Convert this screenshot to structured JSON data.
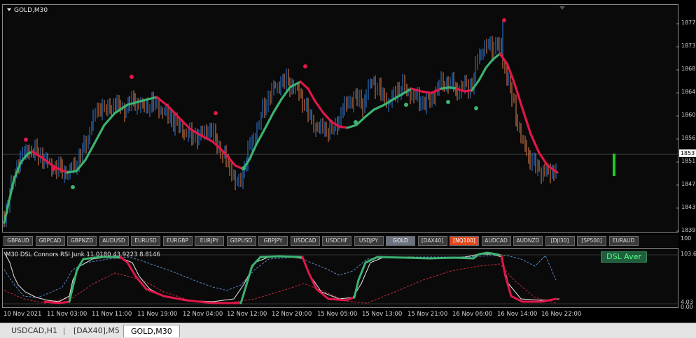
{
  "colors": {
    "background": "#000000",
    "bull_candle": "#2f7fe0",
    "bear_candle": "#e8834a",
    "dsl_up": "#3cb371",
    "dsl_down": "#e0174a",
    "rsi_line": "#e8e8e8",
    "level_blue": "#5a8ac8",
    "level_red": "#c8283c",
    "signal_bar": "#22cc22",
    "alert_button": "#e2451a"
  },
  "chart": {
    "symbol_title": "GOLD,M30",
    "current_price": "1853",
    "price_ticks": [
      "1877",
      "1873",
      "1868",
      "1864",
      "1860",
      "1856",
      "1851",
      "1847",
      "1843",
      "1839"
    ],
    "price_range": [
      1839,
      1879
    ],
    "current_price_value": 1853
  },
  "symbols": [
    {
      "label": "GBPAUD",
      "state": "normal"
    },
    {
      "label": "GBPCAD",
      "state": "normal"
    },
    {
      "label": "GBPNZD",
      "state": "normal"
    },
    {
      "label": "AUDUSD",
      "state": "normal"
    },
    {
      "label": "EURUSD",
      "state": "normal"
    },
    {
      "label": "EURGBP",
      "state": "normal"
    },
    {
      "label": "EURJPY",
      "state": "normal"
    },
    {
      "label": "GBPUSD",
      "state": "normal"
    },
    {
      "label": "GBPJPY",
      "state": "normal"
    },
    {
      "label": "USDCAD",
      "state": "normal"
    },
    {
      "label": "USDCHF",
      "state": "normal"
    },
    {
      "label": "USDJPY",
      "state": "normal"
    },
    {
      "label": "GOLD",
      "state": "active"
    },
    {
      "label": "[DAX40]",
      "state": "normal"
    },
    {
      "label": "[NQ100]",
      "state": "alert"
    },
    {
      "label": "AUDCAD",
      "state": "normal"
    },
    {
      "label": "AUDNZD",
      "state": "normal"
    },
    {
      "label": "[DJI30]",
      "state": "normal"
    },
    {
      "label": "[SP500]",
      "state": "normal"
    },
    {
      "label": "EURAUD",
      "state": "normal"
    }
  ],
  "indicator": {
    "title": "M30 DSL Connors RSI Junk 11.0180 43.9223 8.8146",
    "badge": "DSL Aver",
    "ticks": {
      "top": "100",
      "upper": "103.6",
      "lower": "4.03",
      "bottom": "0.00"
    }
  },
  "time_labels": [
    "10 Nov 2021",
    "11 Nov 03:00",
    "11 Nov 11:00",
    "11 Nov 19:00",
    "12 Nov 04:00",
    "12 Nov 12:00",
    "12 Nov 20:00",
    "15 Nov 05:00",
    "15 Nov 13:00",
    "15 Nov 21:00",
    "16 Nov 06:00",
    "16 Nov 14:00",
    "16 Nov 22:00"
  ],
  "tabs": [
    {
      "label": "USDCAD,H1",
      "active": false
    },
    {
      "label": "[DAX40],M5",
      "active": false
    },
    {
      "label": "GOLD,M30",
      "active": true
    }
  ]
}
